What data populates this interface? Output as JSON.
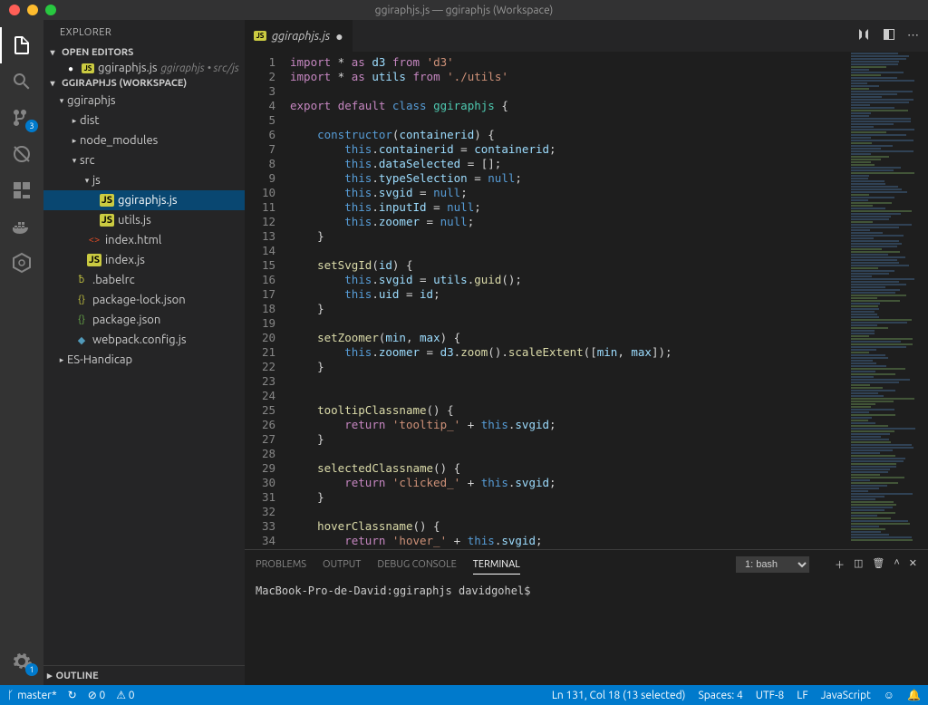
{
  "window_title": "ggiraphjs.js — ggiraphjs (Workspace)",
  "sidebar": {
    "title": "EXPLORER",
    "open_editors_head": "OPEN EDITORS",
    "open_editor": {
      "name": "ggiraphjs.js",
      "path": "ggiraphjs • src/js"
    },
    "workspace_head": "GGIRAPHJS (WORKSPACE)",
    "tree": {
      "root": "ggiraphjs",
      "dist": "dist",
      "node_modules": "node_modules",
      "src": "src",
      "js": "js",
      "file_ggiraph": "ggiraphjs.js",
      "file_utils": "utils.js",
      "file_index_html": "index.html",
      "file_index_js": "index.js",
      "file_babelrc": ".babelrc",
      "file_pkg_lock": "package-lock.json",
      "file_pkg": "package.json",
      "file_webpack": "webpack.config.js",
      "es_handicap": "ES-Handicap"
    },
    "outline": "OUTLINE"
  },
  "activity_badges": {
    "scm": "3",
    "settings": "1"
  },
  "tab": {
    "name": "ggiraphjs.js"
  },
  "code_lines": [
    [
      {
        "t": "kw",
        "v": "import"
      },
      {
        "t": "p",
        "v": " * "
      },
      {
        "t": "kw",
        "v": "as"
      },
      {
        "t": "p",
        "v": " "
      },
      {
        "t": "var",
        "v": "d3"
      },
      {
        "t": "p",
        "v": " "
      },
      {
        "t": "kw",
        "v": "from"
      },
      {
        "t": "p",
        "v": " "
      },
      {
        "t": "str",
        "v": "'d3'"
      }
    ],
    [
      {
        "t": "kw",
        "v": "import"
      },
      {
        "t": "p",
        "v": " * "
      },
      {
        "t": "kw",
        "v": "as"
      },
      {
        "t": "p",
        "v": " "
      },
      {
        "t": "var",
        "v": "utils"
      },
      {
        "t": "p",
        "v": " "
      },
      {
        "t": "kw",
        "v": "from"
      },
      {
        "t": "p",
        "v": " "
      },
      {
        "t": "str",
        "v": "'./utils'"
      }
    ],
    [],
    [
      {
        "t": "kw",
        "v": "export"
      },
      {
        "t": "p",
        "v": " "
      },
      {
        "t": "kw",
        "v": "default"
      },
      {
        "t": "p",
        "v": " "
      },
      {
        "t": "blue",
        "v": "class"
      },
      {
        "t": "p",
        "v": " "
      },
      {
        "t": "type",
        "v": "ggiraphjs"
      },
      {
        "t": "p",
        "v": " {"
      }
    ],
    [],
    [
      {
        "t": "p",
        "v": "    "
      },
      {
        "t": "blue",
        "v": "constructor"
      },
      {
        "t": "p",
        "v": "("
      },
      {
        "t": "var",
        "v": "containerid"
      },
      {
        "t": "p",
        "v": ") {"
      }
    ],
    [
      {
        "t": "p",
        "v": "        "
      },
      {
        "t": "this",
        "v": "this"
      },
      {
        "t": "p",
        "v": "."
      },
      {
        "t": "var",
        "v": "containerid"
      },
      {
        "t": "p",
        "v": " = "
      },
      {
        "t": "var",
        "v": "containerid"
      },
      {
        "t": "p",
        "v": ";"
      }
    ],
    [
      {
        "t": "p",
        "v": "        "
      },
      {
        "t": "this",
        "v": "this"
      },
      {
        "t": "p",
        "v": "."
      },
      {
        "t": "var",
        "v": "dataSelected"
      },
      {
        "t": "p",
        "v": " = [];"
      }
    ],
    [
      {
        "t": "p",
        "v": "        "
      },
      {
        "t": "this",
        "v": "this"
      },
      {
        "t": "p",
        "v": "."
      },
      {
        "t": "var",
        "v": "typeSelection"
      },
      {
        "t": "p",
        "v": " = "
      },
      {
        "t": "blue",
        "v": "null"
      },
      {
        "t": "p",
        "v": ";"
      }
    ],
    [
      {
        "t": "p",
        "v": "        "
      },
      {
        "t": "this",
        "v": "this"
      },
      {
        "t": "p",
        "v": "."
      },
      {
        "t": "var",
        "v": "svgid"
      },
      {
        "t": "p",
        "v": " = "
      },
      {
        "t": "blue",
        "v": "null"
      },
      {
        "t": "p",
        "v": ";"
      }
    ],
    [
      {
        "t": "p",
        "v": "        "
      },
      {
        "t": "this",
        "v": "this"
      },
      {
        "t": "p",
        "v": "."
      },
      {
        "t": "var",
        "v": "inputId"
      },
      {
        "t": "p",
        "v": " = "
      },
      {
        "t": "blue",
        "v": "null"
      },
      {
        "t": "p",
        "v": ";"
      }
    ],
    [
      {
        "t": "p",
        "v": "        "
      },
      {
        "t": "this",
        "v": "this"
      },
      {
        "t": "p",
        "v": "."
      },
      {
        "t": "var",
        "v": "zoomer"
      },
      {
        "t": "p",
        "v": " = "
      },
      {
        "t": "blue",
        "v": "null"
      },
      {
        "t": "p",
        "v": ";"
      }
    ],
    [
      {
        "t": "p",
        "v": "    }"
      }
    ],
    [],
    [
      {
        "t": "p",
        "v": "    "
      },
      {
        "t": "fn",
        "v": "setSvgId"
      },
      {
        "t": "p",
        "v": "("
      },
      {
        "t": "var",
        "v": "id"
      },
      {
        "t": "p",
        "v": ") {"
      }
    ],
    [
      {
        "t": "p",
        "v": "        "
      },
      {
        "t": "this",
        "v": "this"
      },
      {
        "t": "p",
        "v": "."
      },
      {
        "t": "var",
        "v": "svgid"
      },
      {
        "t": "p",
        "v": " = "
      },
      {
        "t": "var",
        "v": "utils"
      },
      {
        "t": "p",
        "v": "."
      },
      {
        "t": "fn",
        "v": "guid"
      },
      {
        "t": "p",
        "v": "();"
      }
    ],
    [
      {
        "t": "p",
        "v": "        "
      },
      {
        "t": "this",
        "v": "this"
      },
      {
        "t": "p",
        "v": "."
      },
      {
        "t": "var",
        "v": "uid"
      },
      {
        "t": "p",
        "v": " = "
      },
      {
        "t": "var",
        "v": "id"
      },
      {
        "t": "p",
        "v": ";"
      }
    ],
    [
      {
        "t": "p",
        "v": "    }"
      }
    ],
    [],
    [
      {
        "t": "p",
        "v": "    "
      },
      {
        "t": "fn",
        "v": "setZoomer"
      },
      {
        "t": "p",
        "v": "("
      },
      {
        "t": "var",
        "v": "min"
      },
      {
        "t": "p",
        "v": ", "
      },
      {
        "t": "var",
        "v": "max"
      },
      {
        "t": "p",
        "v": ") {"
      }
    ],
    [
      {
        "t": "p",
        "v": "        "
      },
      {
        "t": "this",
        "v": "this"
      },
      {
        "t": "p",
        "v": "."
      },
      {
        "t": "var",
        "v": "zoomer"
      },
      {
        "t": "p",
        "v": " = "
      },
      {
        "t": "var",
        "v": "d3"
      },
      {
        "t": "p",
        "v": "."
      },
      {
        "t": "fn",
        "v": "zoom"
      },
      {
        "t": "p",
        "v": "()."
      },
      {
        "t": "fn",
        "v": "scaleExtent"
      },
      {
        "t": "p",
        "v": "(["
      },
      {
        "t": "var",
        "v": "min"
      },
      {
        "t": "p",
        "v": ", "
      },
      {
        "t": "var",
        "v": "max"
      },
      {
        "t": "p",
        "v": "]);"
      }
    ],
    [
      {
        "t": "p",
        "v": "    }"
      }
    ],
    [],
    [],
    [
      {
        "t": "p",
        "v": "    "
      },
      {
        "t": "fn",
        "v": "tooltipClassname"
      },
      {
        "t": "p",
        "v": "() {"
      }
    ],
    [
      {
        "t": "p",
        "v": "        "
      },
      {
        "t": "kw",
        "v": "return"
      },
      {
        "t": "p",
        "v": " "
      },
      {
        "t": "str",
        "v": "'tooltip_'"
      },
      {
        "t": "p",
        "v": " + "
      },
      {
        "t": "this",
        "v": "this"
      },
      {
        "t": "p",
        "v": "."
      },
      {
        "t": "var",
        "v": "svgid"
      },
      {
        "t": "p",
        "v": ";"
      }
    ],
    [
      {
        "t": "p",
        "v": "    }"
      }
    ],
    [],
    [
      {
        "t": "p",
        "v": "    "
      },
      {
        "t": "fn",
        "v": "selectedClassname"
      },
      {
        "t": "p",
        "v": "() {"
      }
    ],
    [
      {
        "t": "p",
        "v": "        "
      },
      {
        "t": "kw",
        "v": "return"
      },
      {
        "t": "p",
        "v": " "
      },
      {
        "t": "str",
        "v": "'clicked_'"
      },
      {
        "t": "p",
        "v": " + "
      },
      {
        "t": "this",
        "v": "this"
      },
      {
        "t": "p",
        "v": "."
      },
      {
        "t": "var",
        "v": "svgid"
      },
      {
        "t": "p",
        "v": ";"
      }
    ],
    [
      {
        "t": "p",
        "v": "    }"
      }
    ],
    [],
    [
      {
        "t": "p",
        "v": "    "
      },
      {
        "t": "fn",
        "v": "hoverClassname"
      },
      {
        "t": "p",
        "v": "() {"
      }
    ],
    [
      {
        "t": "p",
        "v": "        "
      },
      {
        "t": "kw",
        "v": "return"
      },
      {
        "t": "p",
        "v": " "
      },
      {
        "t": "str",
        "v": "'hover_'"
      },
      {
        "t": "p",
        "v": " + "
      },
      {
        "t": "this",
        "v": "this"
      },
      {
        "t": "p",
        "v": "."
      },
      {
        "t": "var",
        "v": "svgid"
      },
      {
        "t": "p",
        "v": ";"
      }
    ]
  ],
  "panel": {
    "tabs": {
      "problems": "PROBLEMS",
      "output": "OUTPUT",
      "debug": "DEBUG CONSOLE",
      "terminal": "TERMINAL"
    },
    "select": "1: bash",
    "prompt": "MacBook-Pro-de-David:ggiraphjs davidgohel$"
  },
  "status": {
    "branch": "master*",
    "sync": "↻",
    "errors": "⊘ 0",
    "warnings": "⚠ 0",
    "ln_col": "Ln 131, Col 18 (13 selected)",
    "spaces": "Spaces: 4",
    "encoding": "UTF-8",
    "eol": "LF",
    "lang": "JavaScript",
    "smile": "☺",
    "bell": "🔔"
  }
}
